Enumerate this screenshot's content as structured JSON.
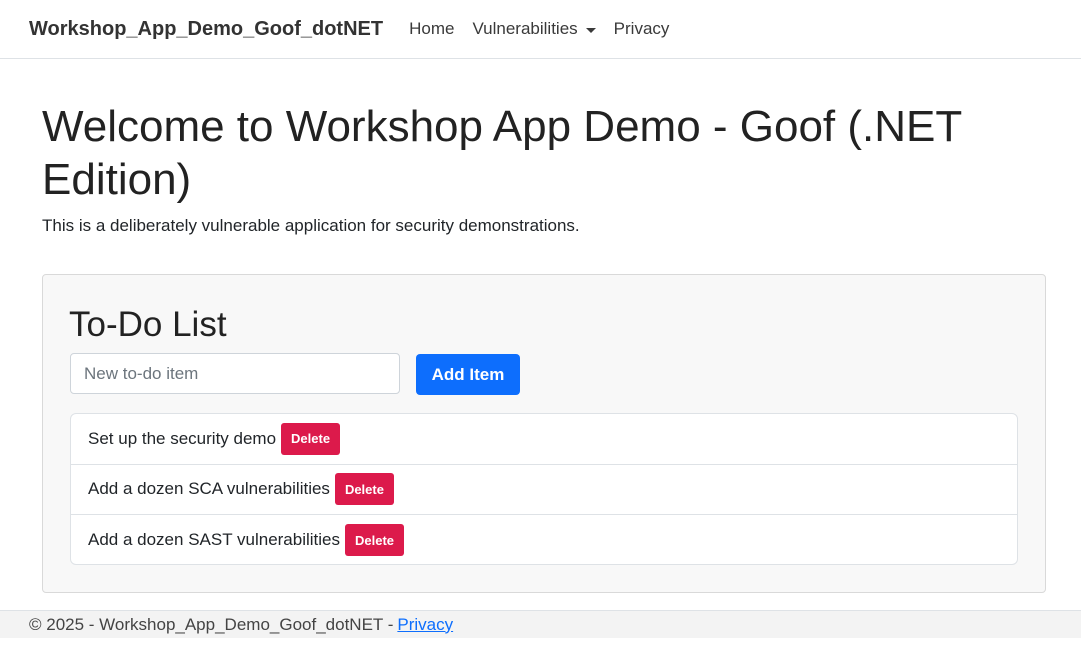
{
  "navbar": {
    "brand": "Workshop_App_Demo_Goof_dotNET",
    "links": [
      {
        "label": "Home"
      },
      {
        "label": "Vulnerabilities"
      },
      {
        "label": "Privacy"
      }
    ]
  },
  "hero": {
    "title": "Welcome to Workshop App Demo - Goof (.NET Edition)",
    "subtitle": "This is a deliberately vulnerable application for security demonstrations."
  },
  "todo": {
    "title": "To-Do List",
    "input_placeholder": "New to-do item",
    "add_label": "Add Item",
    "items": [
      {
        "text": "Set up the security demo",
        "delete_label": "Delete"
      },
      {
        "text": "Add a dozen SCA vulnerabilities",
        "delete_label": "Delete"
      },
      {
        "text": "Add a dozen SAST vulnerabilities",
        "delete_label": "Delete"
      }
    ]
  },
  "footer": {
    "text": "© 2025 - Workshop_App_Demo_Goof_dotNET -",
    "link_label": "Privacy"
  },
  "colors": {
    "primary": "#0d6efd",
    "danger": "#dc1a4b",
    "card_background": "#f8f8f8",
    "footer_background": "#f3f3f3"
  }
}
